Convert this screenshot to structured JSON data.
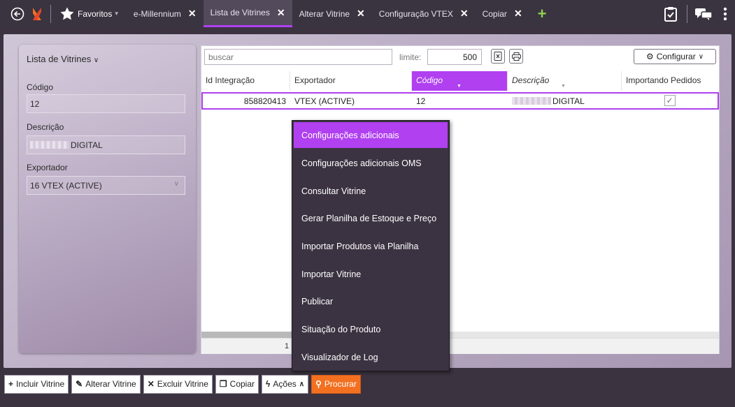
{
  "topbar": {
    "favorites_label": "Favoritos",
    "tabs": [
      {
        "label": "e-Millennium",
        "close": "✕"
      },
      {
        "label": "Lista de Vitrines",
        "close": "✕"
      },
      {
        "label": "Alterar Vitrine",
        "close": "✕"
      },
      {
        "label": "Configuração VTEX",
        "close": "✕"
      },
      {
        "label": "Copiar",
        "close": "✕"
      }
    ],
    "add_tab": "+"
  },
  "left_panel": {
    "title": "Lista de Vitrines",
    "codigo_label": "Código",
    "codigo_value": "12",
    "descricao_label": "Descrição",
    "descricao_value": "DIGITAL",
    "exportador_label": "Exportador",
    "exportador_value": "16 VTEX (ACTIVE)"
  },
  "grid": {
    "search_placeholder": "buscar",
    "limite_label": "limite:",
    "limite_value": "500",
    "configure_label": "Configurar",
    "columns": [
      "Id Integração",
      "Exportador",
      "Código",
      "Descrição",
      "Importando Pedidos"
    ],
    "rows": [
      {
        "id_integracao": "858820413",
        "exportador": "VTEX (ACTIVE)",
        "codigo": "12",
        "descricao": "DIGITAL",
        "importando_pedidos": true
      }
    ],
    "footer_page": "1"
  },
  "context_menu": {
    "items": [
      "Configurações adicionais",
      "Configurações adicionais OMS",
      "Consultar Vitrine",
      "Gerar Planilha de Estoque e Preço",
      "Importar Produtos via Planilha",
      "Importar Vitrine",
      "Publicar",
      "Situação do Produto",
      "Visualizador de Log"
    ],
    "active_index": 0
  },
  "bottom_toolbar": {
    "incluir": "Incluir Vitrine",
    "alterar": "Alterar Vitrine",
    "excluir": "Excluir Vitrine",
    "copiar": "Copiar",
    "acoes": "Ações",
    "procurar": "Procurar"
  },
  "colors": {
    "accent": "#b040f0",
    "topbar_bg": "#3a3340",
    "menu_bg": "#3c3342",
    "procurar_bg": "#f37021"
  }
}
